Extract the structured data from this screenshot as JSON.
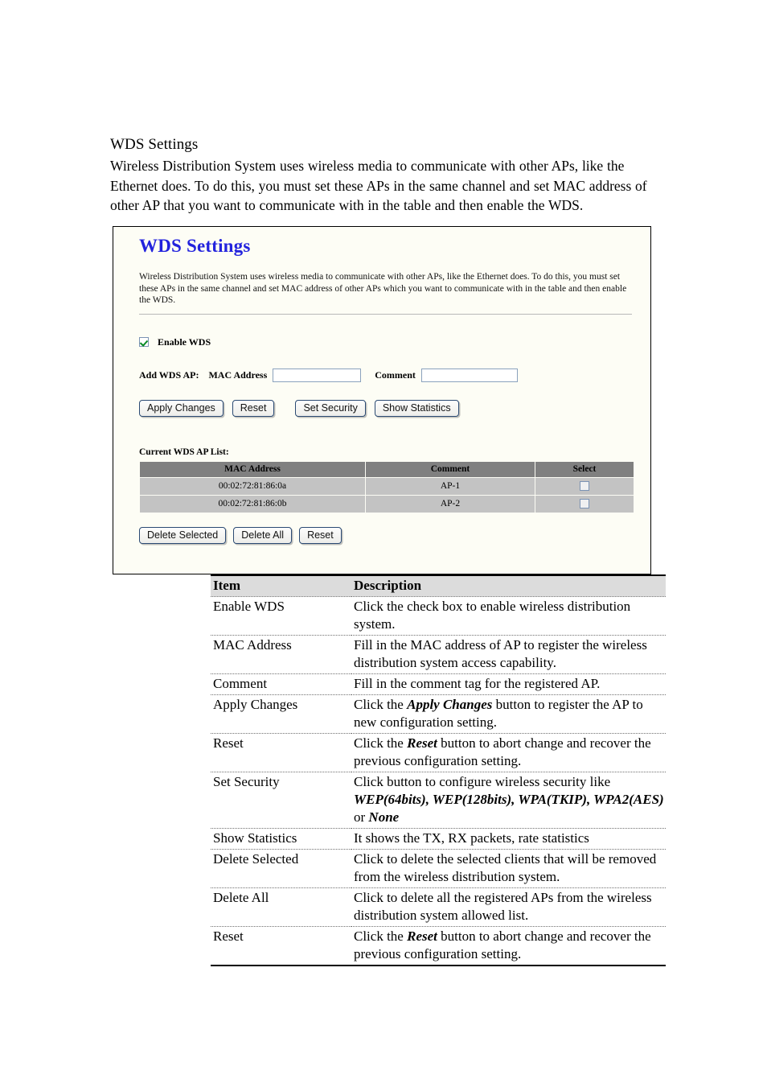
{
  "document": {
    "heading": "WDS Settings",
    "paragraph": "Wireless Distribution System uses wireless media to communicate with other APs, like the Ethernet does. To do this, you must set these APs in the same channel and set MAC address of other AP that you want to communicate with in the table and then enable the WDS."
  },
  "panel": {
    "title": "WDS Settings",
    "description": "Wireless Distribution System uses wireless media to communicate with other APs, like the Ethernet does. To do this, you must set these APs in the same channel and set MAC address of other APs which you want to communicate with in the table and then enable the WDS.",
    "enable_wds": {
      "label": "Enable WDS",
      "checked": true
    },
    "add_ap": {
      "prefix_label": "Add WDS AP:",
      "mac_label": "MAC Address",
      "mac_value": "",
      "comment_label": "Comment",
      "comment_value": ""
    },
    "buttons": {
      "apply_changes": "Apply Changes",
      "reset": "Reset",
      "set_security": "Set Security",
      "show_statistics": "Show Statistics",
      "delete_selected": "Delete Selected",
      "delete_all": "Delete All",
      "reset_2": "Reset"
    },
    "ap_list": {
      "label": "Current WDS AP List:",
      "columns": [
        "MAC Address",
        "Comment",
        "Select"
      ],
      "rows": [
        {
          "mac": "00:02:72:81:86:0a",
          "comment": "AP-1",
          "selected": false
        },
        {
          "mac": "00:02:72:81:86:0b",
          "comment": "AP-2",
          "selected": false
        }
      ]
    },
    "colors": {
      "title": "#2222dd",
      "table_header_bg": "#808080",
      "table_row_bg": "#c3c3c3",
      "panel_bg": "#fdfdf5"
    }
  },
  "description_table": {
    "headers": [
      "Item",
      "Description"
    ],
    "rows": [
      {
        "item": "Enable WDS",
        "desc": "Click the check box to enable wireless distribution system."
      },
      {
        "item": "MAC Address",
        "desc": "Fill in the MAC address of AP to register the wireless distribution system access capability."
      },
      {
        "item": "Comment",
        "desc": "Fill in the comment tag for the registered AP."
      },
      {
        "item": "Apply Changes",
        "desc": "Click the Apply Changes button to register the AP to new configuration setting.",
        "emphasis": [
          "Apply Changes"
        ]
      },
      {
        "item": "Reset",
        "desc": "Click the Reset button to abort change and recover the previous configuration setting.",
        "emphasis": [
          "Reset"
        ]
      },
      {
        "item": "Set Security",
        "desc": "Click button to configure wireless security like WEP(64bits), WEP(128bits), WPA(TKIP), WPA2(AES) or None",
        "emphasis": [
          "WEP(64bits), WEP(128bits), WPA(TKIP), WPA2(AES)",
          "None"
        ]
      },
      {
        "item": "Show Statistics",
        "desc": "It shows the TX, RX packets, rate statistics"
      },
      {
        "item": "Delete Selected",
        "desc": "Click to delete the selected clients that will be removed from the wireless distribution system."
      },
      {
        "item": "Delete All",
        "desc": "Click to delete all the registered APs from the wireless distribution system allowed list."
      },
      {
        "item": "Reset",
        "desc": "Click the Reset button to abort change and recover the previous configuration setting.",
        "emphasis": [
          "Reset"
        ]
      }
    ]
  }
}
